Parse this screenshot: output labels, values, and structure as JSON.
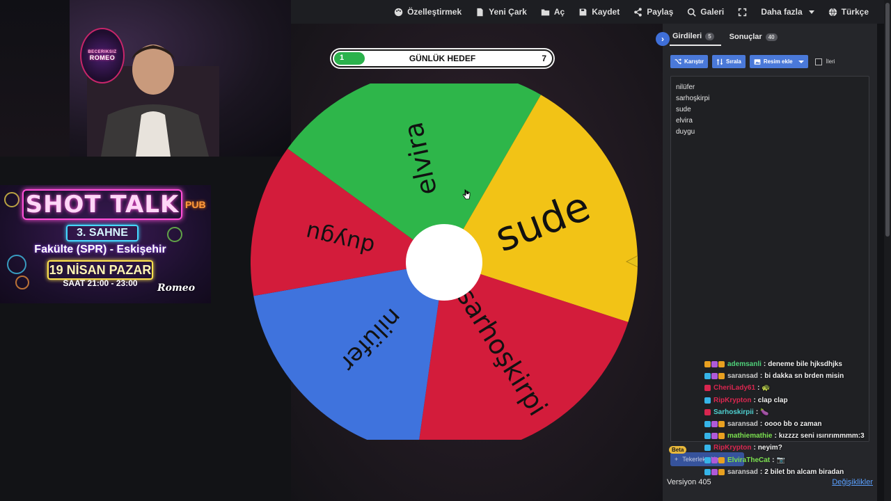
{
  "nav": {
    "items": [
      {
        "icon": "palette-icon",
        "label": "Özelleştirmek"
      },
      {
        "icon": "file-icon",
        "label": "Yeni Çark"
      },
      {
        "icon": "folder-open-icon",
        "label": "Aç"
      },
      {
        "icon": "save-icon",
        "label": "Kaydet"
      },
      {
        "icon": "share-icon",
        "label": "Paylaş"
      },
      {
        "icon": "search-icon",
        "label": "Galeri"
      },
      {
        "icon": "fullscreen-icon",
        "label": ""
      },
      {
        "icon": "",
        "label": "Daha fazla"
      },
      {
        "icon": "globe-icon",
        "label": "Türkçe"
      }
    ]
  },
  "webcam": {
    "logo_top": "BECERIKSIZ",
    "logo_name": "ROMEO"
  },
  "poster": {
    "title": "SHOT TALK",
    "stage": "3. SAHNE",
    "location": "Fakülte (SPR) - Eskişehir",
    "date": "19 NİSAN PAZAR",
    "time": "SAAT 21:00 - 23:00",
    "sign": "PUB",
    "signature": "Romeo"
  },
  "goal": {
    "start": "1",
    "label": "GÜNLÜK HEDEF",
    "end": "7",
    "progress": 0.14
  },
  "wheel": {
    "colors": {
      "green": "#2eb64a",
      "yellow": "#f2c316",
      "red": "#d31c3b",
      "blue": "#3f73dd",
      "hub": "#ffffff",
      "pointer": "#e8c21a"
    },
    "segments": [
      {
        "label": "elvira",
        "color": "#2eb64a"
      },
      {
        "label": "sude",
        "color": "#f2c316"
      },
      {
        "label": "sarhoşkirpi",
        "color": "#d31c3b"
      },
      {
        "label": "nilüfer",
        "color": "#3f73dd"
      },
      {
        "label": "duygu",
        "color": "#d31c3b"
      }
    ]
  },
  "panel": {
    "tabs": [
      {
        "label": "Girdileri",
        "count": "5"
      },
      {
        "label": "Sonuçlar",
        "count": "40"
      }
    ],
    "toolbar": {
      "shuffle": "Karıştır",
      "sort": "Sırala",
      "add_image": "Resim ekle",
      "advanced": "İleri"
    },
    "entries": [
      "nilüfer",
      "sarhoşkirpi",
      "sude",
      "elvira",
      "duygu"
    ],
    "beta": "Beta",
    "wheel_add": "Tekerlek ekle",
    "version": "Versiyon 405",
    "changes": "Değişiklikler"
  },
  "chat": [
    {
      "user": "ademsanli",
      "color": "#4fd17a",
      "text": "deneme bile hjksdhjks",
      "badges": [
        "#e8a020",
        "#b05ad8",
        "#e8a020"
      ]
    },
    {
      "user": "saransad",
      "color": "#c9c9c9",
      "text": "bi dakka sn brden misin",
      "badges": [
        "#36b4e8",
        "#b05ad8",
        "#e8a020"
      ]
    },
    {
      "user": "CheriLady61",
      "color": "#d8264f",
      "text": "🐢",
      "badges": [
        "#d8264f"
      ]
    },
    {
      "user": "RipKrypton",
      "color": "#d8264f",
      "text": "clap clap",
      "badges": [
        "#36b4e8"
      ]
    },
    {
      "user": "Sarhoskirpii",
      "color": "#4fd1d1",
      "text": "🍆",
      "badges": [
        "#d8264f"
      ]
    },
    {
      "user": "saransad",
      "color": "#c9c9c9",
      "text": "oooo bb o zaman",
      "badges": [
        "#36b4e8",
        "#b05ad8",
        "#e8a020"
      ]
    },
    {
      "user": "mathiemathie",
      "color": "#7be04f",
      "text": "kızzzz seni ısırırımmmm:3",
      "badges": [
        "#36b4e8",
        "#b05ad8",
        "#e8a020"
      ]
    },
    {
      "user": "RipKrypton",
      "color": "#d8264f",
      "text": "neyim?",
      "badges": [
        "#36b4e8"
      ]
    },
    {
      "user": "ElviraTheCat",
      "color": "#7be04f",
      "text": "📷",
      "badges": [
        "#36b4e8",
        "#b05ad8",
        "#e8a020"
      ]
    },
    {
      "user": "saransad",
      "color": "#c9c9c9",
      "text": "2 bilet bn alcam biradan",
      "badges": [
        "#36b4e8",
        "#b05ad8",
        "#e8a020"
      ]
    }
  ]
}
